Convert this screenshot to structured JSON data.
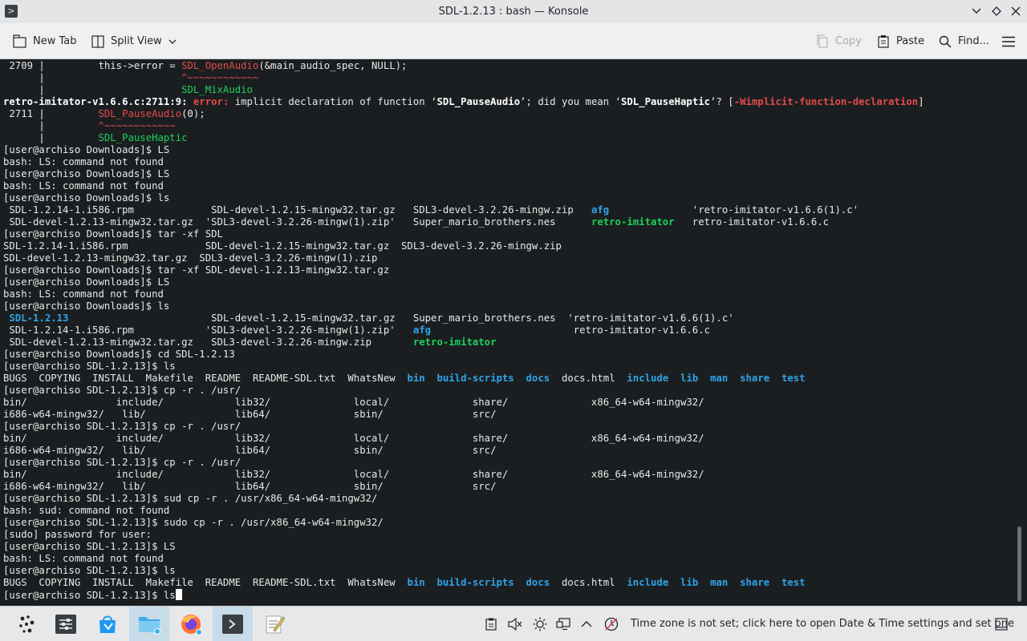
{
  "window": {
    "title": "SDL-1.2.13 : bash — Konsole",
    "app_icon": ">"
  },
  "toolbar": {
    "new_tab": "New Tab",
    "split_view": "Split View",
    "copy": "Copy",
    "paste": "Paste",
    "find": "Find..."
  },
  "terminal": {
    "lines": [
      [
        {
          "t": " 2709 |         this->error = "
        },
        {
          "t": "SDL_OpenAudio",
          "c": "c-red"
        },
        {
          "t": "(&main_audio_spec, NULL);"
        }
      ],
      [
        {
          "t": "      |                       "
        },
        {
          "t": "^~~~~~~~~~~~~",
          "c": "c-red"
        }
      ],
      [
        {
          "t": "      |                       "
        },
        {
          "t": "SDL_MixAudio",
          "c": "c-green"
        }
      ],
      [
        {
          "t": "retro-imitator-v1.6.6.c:2711:9: ",
          "c": "c-white-b"
        },
        {
          "t": "error: ",
          "c": "c-redb"
        },
        {
          "t": "implicit declaration of function ‘"
        },
        {
          "t": "SDL_PauseAudio",
          "c": "c-white-b"
        },
        {
          "t": "’; did you mean ‘"
        },
        {
          "t": "SDL_PauseHaptic",
          "c": "c-white-b"
        },
        {
          "t": "’? ["
        },
        {
          "t": "-Wimplicit-function-declaration",
          "c": "c-redb"
        },
        {
          "t": "]"
        }
      ],
      [
        {
          "t": " 2711 |         "
        },
        {
          "t": "SDL_PauseAudio",
          "c": "c-red"
        },
        {
          "t": "(0);"
        }
      ],
      [
        {
          "t": "      |         "
        },
        {
          "t": "^~~~~~~~~~~~~",
          "c": "c-red"
        }
      ],
      [
        {
          "t": "      |         "
        },
        {
          "t": "SDL_PauseHaptic",
          "c": "c-green"
        }
      ],
      [
        {
          "t": "[user@archiso Downloads]$ LS"
        }
      ],
      [
        {
          "t": "bash: LS: command not found"
        }
      ],
      [
        {
          "t": "[user@archiso Downloads]$ LS"
        }
      ],
      [
        {
          "t": "bash: LS: command not found"
        }
      ],
      [
        {
          "t": "[user@archiso Downloads]$ ls"
        }
      ],
      [
        {
          "t": " SDL-1.2.14-1.i586.rpm             SDL-devel-1.2.15-mingw32.tar.gz   SDL3-devel-3.2.26-mingw.zip   "
        },
        {
          "t": "afg",
          "c": "c-blue"
        },
        {
          "t": "              'retro-imitator-v1.6.6(1).c'"
        }
      ],
      [
        {
          "t": " SDL-devel-1.2.13-mingw32.tar.gz  'SDL3-devel-3.2.26-mingw(1).zip'   Super_mario_brothers.nes      "
        },
        {
          "t": "retro-imitator",
          "c": "c-greenb"
        },
        {
          "t": "   retro-imitator-v1.6.6.c"
        }
      ],
      [
        {
          "t": "[user@archiso Downloads]$ tar -xf SDL"
        }
      ],
      [
        {
          "t": "SDL-1.2.14-1.i586.rpm             SDL-devel-1.2.15-mingw32.tar.gz  SDL3-devel-3.2.26-mingw.zip"
        }
      ],
      [
        {
          "t": "SDL-devel-1.2.13-mingw32.tar.gz  SDL3-devel-3.2.26-mingw(1).zip"
        }
      ],
      [
        {
          "t": "[user@archiso Downloads]$ tar -xf SDL-devel-1.2.13-mingw32.tar.gz"
        }
      ],
      [
        {
          "t": "[user@archiso Downloads]$ LS"
        }
      ],
      [
        {
          "t": "bash: LS: command not found"
        }
      ],
      [
        {
          "t": "[user@archiso Downloads]$ ls"
        }
      ],
      [
        {
          "t": " "
        },
        {
          "t": "SDL-1.2.13",
          "c": "c-blue"
        },
        {
          "t": "                        SDL-devel-1.2.15-mingw32.tar.gz   Super_mario_brothers.nes  'retro-imitator-v1.6.6(1).c'"
        }
      ],
      [
        {
          "t": " SDL-1.2.14-1.i586.rpm            'SDL3-devel-3.2.26-mingw(1).zip'   "
        },
        {
          "t": "afg",
          "c": "c-blue"
        },
        {
          "t": "                        retro-imitator-v1.6.6.c"
        }
      ],
      [
        {
          "t": " SDL-devel-1.2.13-mingw32.tar.gz   SDL3-devel-3.2.26-mingw.zip       "
        },
        {
          "t": "retro-imitator",
          "c": "c-greenb"
        }
      ],
      [
        {
          "t": "[user@archiso Downloads]$ cd SDL-1.2.13"
        }
      ],
      [
        {
          "t": "[user@archiso SDL-1.2.13]$ ls"
        }
      ],
      [
        {
          "t": "BUGS  COPYING  INSTALL  Makefile  README  README-SDL.txt  WhatsNew  "
        },
        {
          "t": "bin",
          "c": "c-blue"
        },
        {
          "t": "  "
        },
        {
          "t": "build-scripts",
          "c": "c-blue"
        },
        {
          "t": "  "
        },
        {
          "t": "docs",
          "c": "c-blue"
        },
        {
          "t": "  docs.html  "
        },
        {
          "t": "include",
          "c": "c-blue"
        },
        {
          "t": "  "
        },
        {
          "t": "lib",
          "c": "c-blue"
        },
        {
          "t": "  "
        },
        {
          "t": "man",
          "c": "c-blue"
        },
        {
          "t": "  "
        },
        {
          "t": "share",
          "c": "c-blue"
        },
        {
          "t": "  "
        },
        {
          "t": "test",
          "c": "c-blue"
        }
      ],
      [
        {
          "t": "[user@archiso SDL-1.2.13]$ cp -r . /usr/"
        }
      ],
      [
        {
          "t": "bin/               include/            lib32/              local/              share/              x86_64-w64-mingw32/"
        }
      ],
      [
        {
          "t": "i686-w64-mingw32/   lib/               lib64/              sbin/               src/"
        }
      ],
      [
        {
          "t": "[user@archiso SDL-1.2.13]$ cp -r . /usr/"
        }
      ],
      [
        {
          "t": "bin/               include/            lib32/              local/              share/              x86_64-w64-mingw32/"
        }
      ],
      [
        {
          "t": "i686-w64-mingw32/   lib/               lib64/              sbin/               src/"
        }
      ],
      [
        {
          "t": "[user@archiso SDL-1.2.13]$ cp -r . /usr/"
        }
      ],
      [
        {
          "t": "bin/               include/            lib32/              local/              share/              x86_64-w64-mingw32/"
        }
      ],
      [
        {
          "t": "i686-w64-mingw32/   lib/               lib64/              sbin/               src/"
        }
      ],
      [
        {
          "t": "[user@archiso SDL-1.2.13]$ sud cp -r . /usr/x86_64-w64-mingw32/"
        }
      ],
      [
        {
          "t": "bash: sud: command not found"
        }
      ],
      [
        {
          "t": "[user@archiso SDL-1.2.13]$ sudo cp -r . /usr/x86_64-w64-mingw32/"
        }
      ],
      [
        {
          "t": "[sudo] password for user:"
        }
      ],
      [
        {
          "t": "[user@archiso SDL-1.2.13]$ LS"
        }
      ],
      [
        {
          "t": "bash: LS: command not found"
        }
      ],
      [
        {
          "t": "[user@archiso SDL-1.2.13]$ ls"
        }
      ],
      [
        {
          "t": "BUGS  COPYING  INSTALL  Makefile  README  README-SDL.txt  WhatsNew  "
        },
        {
          "t": "bin",
          "c": "c-blue"
        },
        {
          "t": "  "
        },
        {
          "t": "build-scripts",
          "c": "c-blue"
        },
        {
          "t": "  "
        },
        {
          "t": "docs",
          "c": "c-blue"
        },
        {
          "t": "  docs.html  "
        },
        {
          "t": "include",
          "c": "c-blue"
        },
        {
          "t": "  "
        },
        {
          "t": "lib",
          "c": "c-blue"
        },
        {
          "t": "  "
        },
        {
          "t": "man",
          "c": "c-blue"
        },
        {
          "t": "  "
        },
        {
          "t": "share",
          "c": "c-blue"
        },
        {
          "t": "  "
        },
        {
          "t": "test",
          "c": "c-blue"
        }
      ]
    ],
    "prompt_line": "[user@archiso SDL-1.2.13]$ ls",
    "colors": {
      "background": "#1b1e20",
      "foreground": "#e8e8e8",
      "directory": "#2ea3e8",
      "error": "#e24a4a",
      "executable": "#1cd05c"
    }
  },
  "taskbar": {
    "tasks": [
      {
        "name": "application-launcher-icon"
      },
      {
        "name": "system-settings-icon"
      },
      {
        "name": "discover-store-icon"
      },
      {
        "name": "file-manager-icon"
      },
      {
        "name": "firefox-icon"
      },
      {
        "name": "konsole-icon"
      },
      {
        "name": "text-editor-icon"
      }
    ],
    "timezone_notice": "Time zone is not set; click here to open Date & Time settings and set one"
  }
}
